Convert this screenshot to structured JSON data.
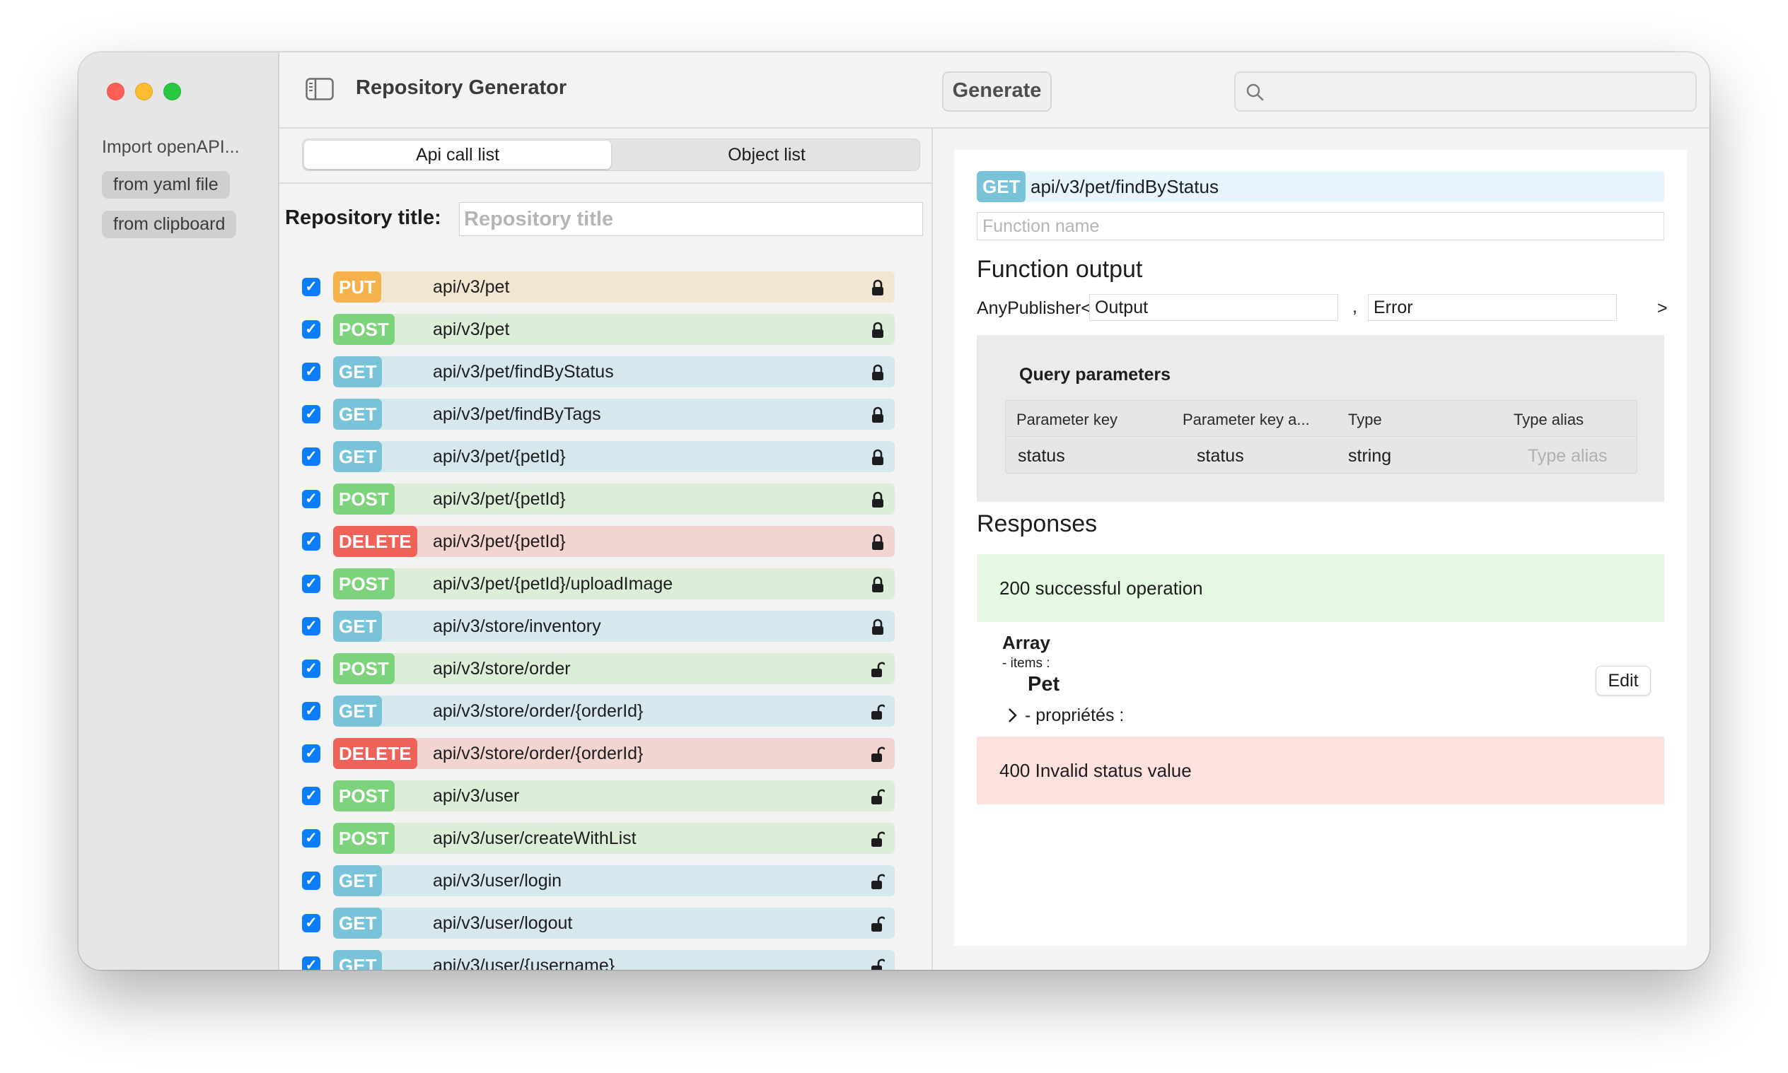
{
  "window": {
    "title": "Repository Generator",
    "generate_label": "Generate",
    "search_placeholder": ""
  },
  "sidebar": {
    "import_title": "Import openAPI...",
    "from_yaml_label": "from yaml file",
    "from_clipboard_label": "from clipboard"
  },
  "tabs": {
    "api_call_list": "Api call list",
    "object_list": "Object list",
    "selected": "Api call list"
  },
  "repository": {
    "label": "Repository title:",
    "placeholder": "Repository title",
    "value": ""
  },
  "method_colors": {
    "PUT": {
      "badge": "#f5b14b",
      "row": "#f3e6d1"
    },
    "POST": {
      "badge": "#7dd37c",
      "row": "#dcedd8"
    },
    "GET": {
      "badge": "#79c3d8",
      "row": "#d6e7ee"
    },
    "DELETE": {
      "badge": "#ee6259",
      "row": "#f2d4d1"
    }
  },
  "endpoints": [
    {
      "method": "PUT",
      "path": "api/v3/pet",
      "checked": true,
      "locked": true
    },
    {
      "method": "POST",
      "path": "api/v3/pet",
      "checked": true,
      "locked": true
    },
    {
      "method": "GET",
      "path": "api/v3/pet/findByStatus",
      "checked": true,
      "locked": true
    },
    {
      "method": "GET",
      "path": "api/v3/pet/findByTags",
      "checked": true,
      "locked": true
    },
    {
      "method": "GET",
      "path": "api/v3/pet/{petId}",
      "checked": true,
      "locked": true
    },
    {
      "method": "POST",
      "path": "api/v3/pet/{petId}",
      "checked": true,
      "locked": true
    },
    {
      "method": "DELETE",
      "path": "api/v3/pet/{petId}",
      "checked": true,
      "locked": true
    },
    {
      "method": "POST",
      "path": "api/v3/pet/{petId}/uploadImage",
      "checked": true,
      "locked": true
    },
    {
      "method": "GET",
      "path": "api/v3/store/inventory",
      "checked": true,
      "locked": true
    },
    {
      "method": "POST",
      "path": "api/v3/store/order",
      "checked": true,
      "locked": false
    },
    {
      "method": "GET",
      "path": "api/v3/store/order/{orderId}",
      "checked": true,
      "locked": false
    },
    {
      "method": "DELETE",
      "path": "api/v3/store/order/{orderId}",
      "checked": true,
      "locked": false
    },
    {
      "method": "POST",
      "path": "api/v3/user",
      "checked": true,
      "locked": false
    },
    {
      "method": "POST",
      "path": "api/v3/user/createWithList",
      "checked": true,
      "locked": false
    },
    {
      "method": "GET",
      "path": "api/v3/user/login",
      "checked": true,
      "locked": false
    },
    {
      "method": "GET",
      "path": "api/v3/user/logout",
      "checked": true,
      "locked": false
    },
    {
      "method": "GET",
      "path": "api/v3/user/{username}",
      "checked": true,
      "locked": false
    }
  ],
  "detail": {
    "method": "GET",
    "path": "api/v3/pet/findByStatus",
    "function_name_placeholder": "Function name",
    "function_name_value": "",
    "function_output_title": "Function output",
    "publisher_prefix": "AnyPublisher<",
    "output_value": "Output",
    "comma": ",",
    "error_value": "Error",
    "publisher_suffix": ">",
    "query": {
      "title": "Query parameters",
      "columns": [
        "Parameter key",
        "Parameter key a...",
        "Type",
        "Type alias"
      ],
      "rows": [
        {
          "key": "status",
          "alias": "status",
          "type": "string",
          "type_alias_placeholder": "Type alias"
        }
      ]
    },
    "responses_title": "Responses",
    "responses": [
      {
        "label": "200 successful operation",
        "color": "#e5f8e2"
      },
      {
        "label": "400 Invalid status value",
        "color": "#fde1df"
      }
    ],
    "schema": {
      "type": "Array",
      "items_label": "- items :",
      "object_name": "Pet",
      "properties_label": "- propriétés :",
      "edit_label": "Edit"
    }
  }
}
